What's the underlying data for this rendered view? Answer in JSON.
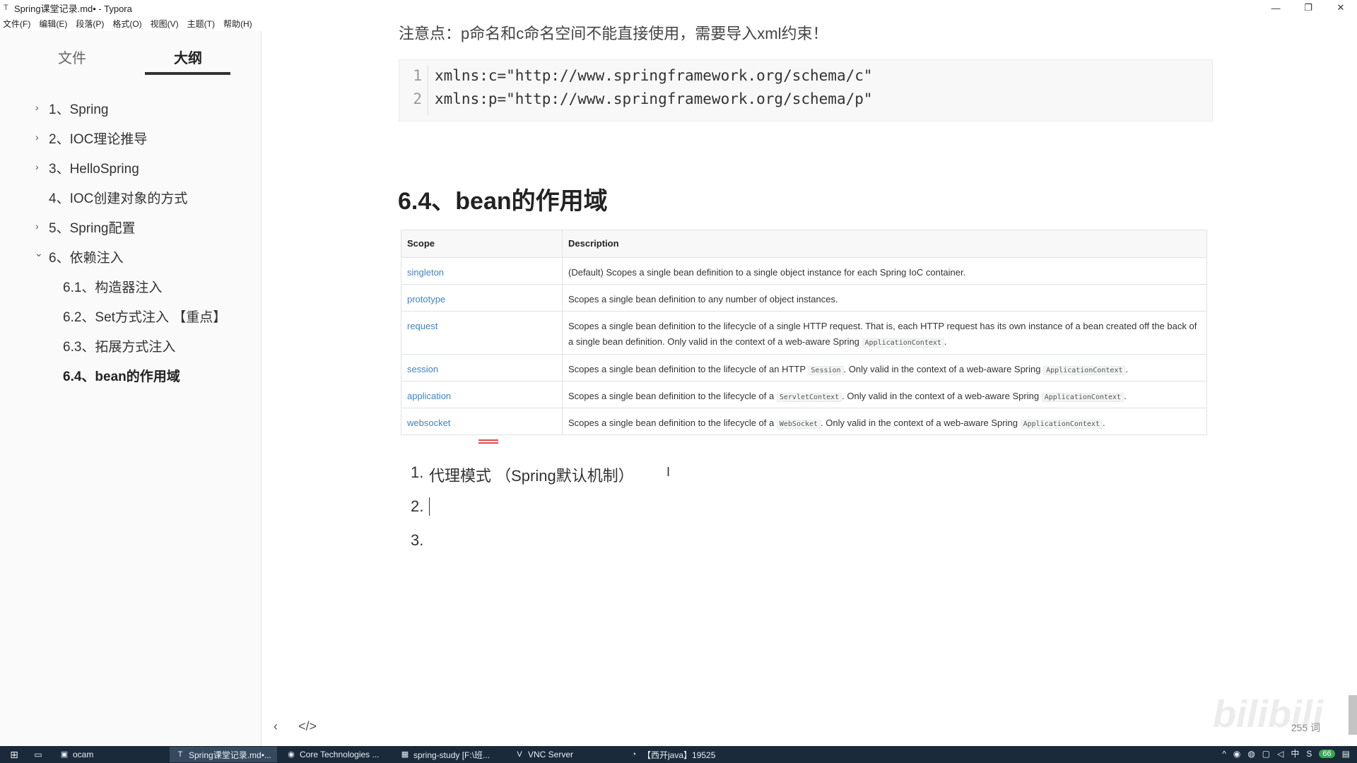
{
  "window": {
    "title": "Spring课堂记录.md• - Typora",
    "controls": {
      "minimize": "—",
      "restore": "❐",
      "close": "✕"
    }
  },
  "menu": [
    "文件(F)",
    "编辑(E)",
    "段落(P)",
    "格式(O)",
    "视图(V)",
    "主题(T)",
    "帮助(H)"
  ],
  "sidebar": {
    "tabs": {
      "files": "文件",
      "outline": "大纲"
    },
    "items": [
      {
        "label": "1、Spring",
        "chevron": "›"
      },
      {
        "label": "2、IOC理论推导",
        "chevron": "›"
      },
      {
        "label": "3、HelloSpring",
        "chevron": "›"
      },
      {
        "label": "4、IOC创建对象的方式",
        "chevron": ""
      },
      {
        "label": "5、Spring配置",
        "chevron": "›"
      },
      {
        "label": "6、依赖注入",
        "chevron": "⌄"
      },
      {
        "label": "6.1、构造器注入",
        "chevron": ""
      },
      {
        "label": "6.2、Set方式注入 【重点】",
        "chevron": ""
      },
      {
        "label": "6.3、拓展方式注入",
        "chevron": ""
      },
      {
        "label": "6.4、bean的作用域",
        "chevron": ""
      }
    ]
  },
  "editor": {
    "cut_text": "注意点：p命名和c命名空间不能直接使用，需要导入xml约束！",
    "code": [
      {
        "n": "1",
        "text": "xmlns:c=\"http://www.springframework.org/schema/c\""
      },
      {
        "n": "2",
        "text": "xmlns:p=\"http://www.springframework.org/schema/p\""
      }
    ],
    "heading": "6.4、bean的作用域",
    "table": {
      "headers": [
        "Scope",
        "Description"
      ],
      "rows": [
        {
          "scope": "singleton",
          "desc": [
            "(Default) Scopes a single bean definition to a single object instance for each Spring IoC container."
          ]
        },
        {
          "scope": "prototype",
          "desc": [
            "Scopes a single bean definition to any number of object instances."
          ]
        },
        {
          "scope": "request",
          "desc": [
            "Scopes a single bean definition to the lifecycle of a single HTTP request. That is, each HTTP request has its own instance of a bean created off the back of a single bean definition. Only valid in the context of a web-aware Spring ",
            "ApplicationContext",
            "."
          ]
        },
        {
          "scope": "session",
          "desc": [
            "Scopes a single bean definition to the lifecycle of an HTTP ",
            "Session",
            ". Only valid in the context of a web-aware Spring ",
            "ApplicationContext",
            "."
          ]
        },
        {
          "scope": "application",
          "desc": [
            "Scopes a single bean definition to the lifecycle of a ",
            "ServletContext",
            ". Only valid in the context of a web-aware Spring ",
            "ApplicationContext",
            "."
          ]
        },
        {
          "scope": "websocket",
          "desc": [
            "Scopes a single bean definition to the lifecycle of a ",
            "WebSocket",
            ". Only valid in the context of a web-aware Spring ",
            "ApplicationContext",
            "."
          ]
        }
      ]
    },
    "list": [
      {
        "num": "1.",
        "text": "代理模式 （Spring默认机制）"
      },
      {
        "num": "2.",
        "text": ""
      },
      {
        "num": "3.",
        "text": ""
      }
    ],
    "bottom": {
      "back": "‹",
      "source": "</>",
      "word_count": "255 词"
    },
    "watermark": "bilibili"
  },
  "taskbar": {
    "items": [
      {
        "label": "ocam",
        "icon": "▣"
      },
      {
        "label": "Spring课堂记录.md•...",
        "icon": "T"
      },
      {
        "label": "Core Technologies ...",
        "icon": "◉"
      },
      {
        "label": "spring-study [F:\\班...",
        "icon": "▦"
      },
      {
        "label": "VNC Server",
        "icon": "V"
      },
      {
        "label": "【西开java】19525",
        "icon": "◔"
      }
    ],
    "tray": {
      "ime": "中",
      "badge": "66"
    }
  },
  "colors": {
    "link": "#4183c4",
    "taskbar": "#1b2a3a",
    "accent_red": "#e24a4a"
  }
}
